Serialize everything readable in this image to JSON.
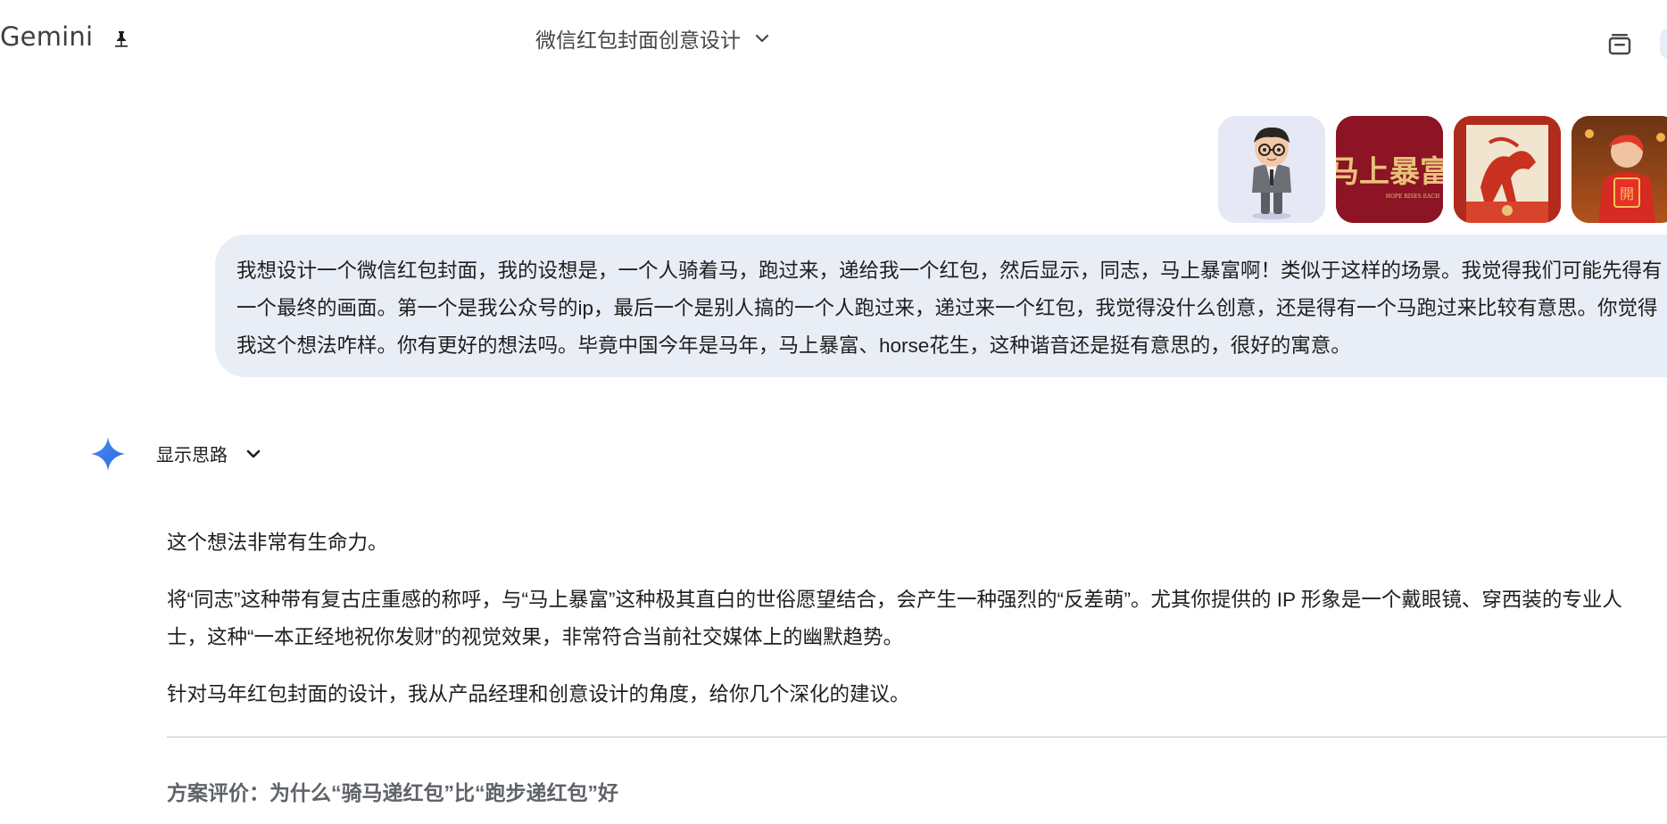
{
  "header": {
    "brand": "Gemini",
    "pin_icon": "pin-icon",
    "conversation_title": "微信红包封面创意设计",
    "history_icon": "history-icon"
  },
  "attachments": [
    {
      "name": "ip-avatar-thumbnail"
    },
    {
      "name": "horse-fortune-calligraphy-thumbnail",
      "text": "马上暴富",
      "subtext": "HOPE RISES EACH"
    },
    {
      "name": "horse-poster-thumbnail"
    },
    {
      "name": "running-person-redpacket-thumbnail",
      "text": "開"
    }
  ],
  "user_message": "我想设计一个微信红包封面，我的设想是，一个人骑着马，跑过来，递给我一个红包，然后显示，同志，马上暴富啊！类似于这样的场景。我觉得我们可能先得有一个最终的画面。第一个是我公众号的ip，最后一个是别人搞的一个人跑过来，递过来一个红包，我觉得没什么创意，还是得有一个马跑过来比较有意思。你觉得我这个想法咋样。你有更好的想法吗。毕竟中国今年是马年，马上暴富、horse花生，这种谐音还是挺有意思的，很好的寓意。",
  "model": {
    "show_thoughts_label": "显示思路",
    "paragraphs": [
      "这个想法非常有生命力。",
      "将“同志”这种带有复古庄重感的称呼，与“马上暴富”这种极其直白的世俗愿望结合，会产生一种强烈的“反差萌”。尤其你提供的 IP 形象是一个戴眼镜、穿西装的专业人士，这种“一本正经地祝你发财”的视觉效果，非常符合当前社交媒体上的幽默趋势。",
      "针对马年红包封面的设计，我从产品经理和创意设计的角度，给你几个深化的建议。"
    ],
    "section_heading": "方案评价：为什么“骑马递红包”比“跑步递红包”好"
  },
  "colors": {
    "bubble": "#e9eef6",
    "spark": "#3b7cf0",
    "heading_gray": "#5f6368"
  }
}
